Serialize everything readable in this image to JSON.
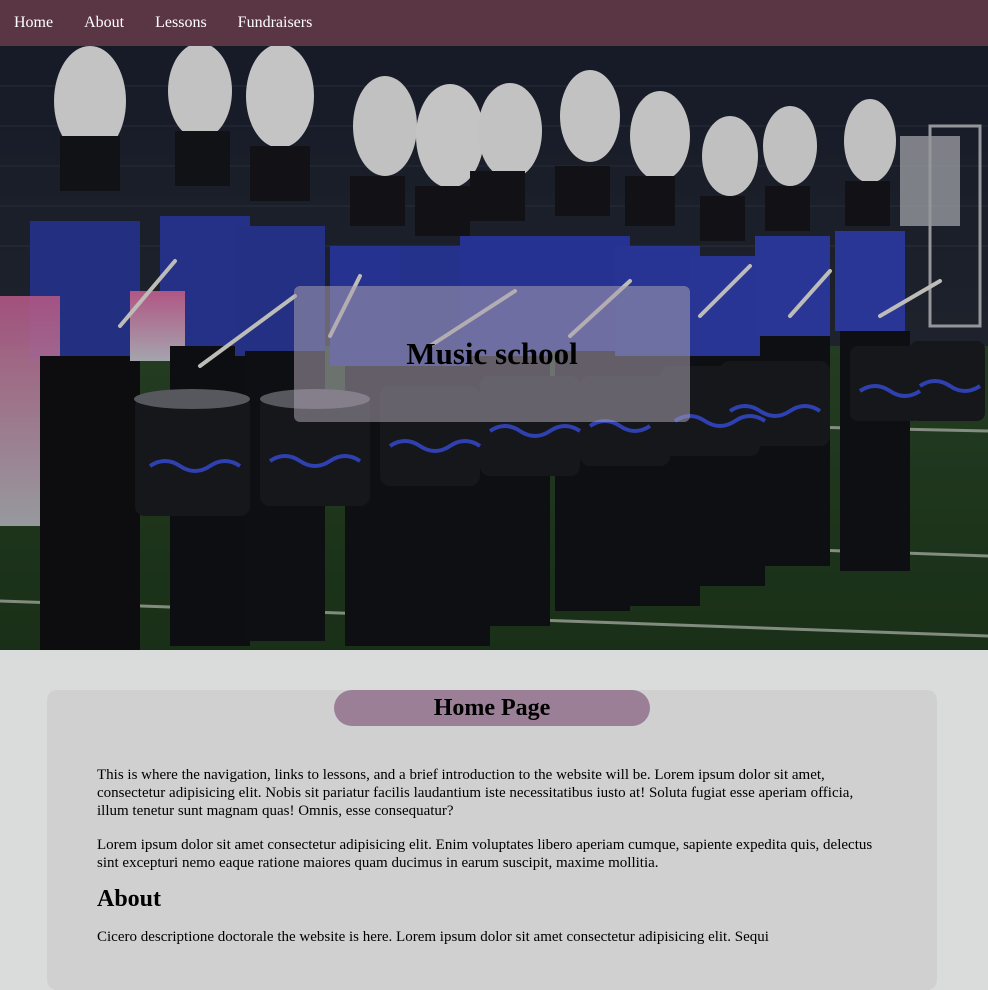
{
  "nav": {
    "items": [
      {
        "label": "Home"
      },
      {
        "label": "About"
      },
      {
        "label": "Lessons"
      },
      {
        "label": "Fundraisers"
      }
    ]
  },
  "hero": {
    "title": "Music school",
    "image": "drumline-marching-band-photo"
  },
  "main": {
    "page_heading": "Home Page",
    "paragraphs": [
      "This is where the navigation, links to lessons, and a brief introduction to the website will be. Lorem ipsum dolor sit amet, consectetur adipisicing elit. Nobis sit pariatur facilis laudantium iste necessitatibus iusto at! Soluta fugiat esse aperiam officia, illum tenetur sunt magnam quas! Omnis, esse consequatur?",
      "Lorem ipsum dolor sit amet consectetur adipisicing elit. Enim voluptates libero aperiam cumque, sapiente expedita quis, delectus sint excepturi nemo eaque ratione maiores quam ducimus in earum suscipit, maxime mollitia."
    ],
    "about_heading": "About",
    "about_text": "Cicero descriptione doctorale the website is here. Lorem ipsum dolor sit amet consectetur adipisicing elit. Sequi"
  },
  "colors": {
    "nav_bg": "#5a3544",
    "pill_bg": "#9a7f96",
    "card_bg": "#d0d0d0",
    "page_bg": "#d9dcdb"
  }
}
